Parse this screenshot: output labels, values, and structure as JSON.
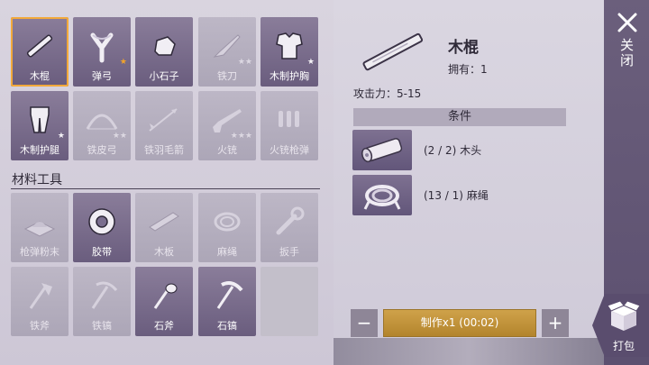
{
  "recipes": [
    {
      "label": "木棍",
      "state": "active",
      "selected": true,
      "stars": "",
      "star_color": "",
      "icon": "stick-icon"
    },
    {
      "label": "弹弓",
      "state": "active",
      "selected": false,
      "stars": "★",
      "star_color": "gold",
      "icon": "slingshot-icon"
    },
    {
      "label": "小石子",
      "state": "active",
      "selected": false,
      "stars": "",
      "star_color": "",
      "icon": "pebble-icon"
    },
    {
      "label": "铁刀",
      "state": "inactive",
      "selected": false,
      "stars": "★★",
      "star_color": "grey",
      "icon": "iron-knife-icon"
    },
    {
      "label": "木制护胸",
      "state": "active",
      "selected": false,
      "stars": "★",
      "star_color": "white",
      "icon": "wooden-chestplate-icon"
    },
    {
      "label": "木制护腿",
      "state": "active",
      "selected": false,
      "stars": "★",
      "star_color": "white",
      "icon": "wooden-leggings-icon"
    },
    {
      "label": "铁皮弓",
      "state": "inactive",
      "selected": false,
      "stars": "★★",
      "star_color": "grey",
      "icon": "iron-bow-icon"
    },
    {
      "label": "铁羽毛箭",
      "state": "inactive",
      "selected": false,
      "stars": "",
      "star_color": "",
      "icon": "iron-arrow-icon"
    },
    {
      "label": "火铳",
      "state": "inactive",
      "selected": false,
      "stars": "★★★",
      "star_color": "grey",
      "icon": "musket-icon"
    },
    {
      "label": "火铳枪弹",
      "state": "inactive",
      "selected": false,
      "stars": "",
      "star_color": "",
      "icon": "musket-ammo-icon"
    }
  ],
  "materials_title": "材料工具",
  "materials": [
    {
      "label": "枪弹粉末",
      "state": "inactive",
      "icon": "gunpowder-icon"
    },
    {
      "label": "胶带",
      "state": "active",
      "icon": "tape-icon"
    },
    {
      "label": "木板",
      "state": "inactive",
      "icon": "plank-icon"
    },
    {
      "label": "麻绳",
      "state": "inactive",
      "icon": "rope-icon"
    },
    {
      "label": "扳手",
      "state": "inactive",
      "icon": "wrench-icon"
    },
    {
      "label": "铁斧",
      "state": "inactive",
      "icon": "iron-axe-icon"
    },
    {
      "label": "铁镐",
      "state": "inactive",
      "icon": "iron-pickaxe-icon"
    },
    {
      "label": "石斧",
      "state": "active",
      "icon": "stone-axe-icon"
    },
    {
      "label": "石镐",
      "state": "active",
      "icon": "stone-pickaxe-icon"
    },
    {
      "label": "",
      "state": "empty",
      "icon": ""
    }
  ],
  "detail": {
    "name": "木棍",
    "owned": "拥有：1",
    "attack": "攻击力：5-15",
    "conditions_title": "条件",
    "requirements": [
      {
        "text": "(2 / 2) 木头",
        "icon": "wood-log-icon"
      },
      {
        "text": "(13 / 1) 麻绳",
        "icon": "rope-icon"
      }
    ]
  },
  "craft": {
    "minus": "−",
    "label": "制作x1 (00:02)",
    "plus": "+"
  },
  "sidebar": {
    "close_label": "关闭",
    "pack_label": "打包"
  },
  "colors": {
    "accent": "#f2a93b",
    "slot_active": "#7a6d8e",
    "craft_button": "#c29638",
    "sidebar": "#63577a"
  }
}
